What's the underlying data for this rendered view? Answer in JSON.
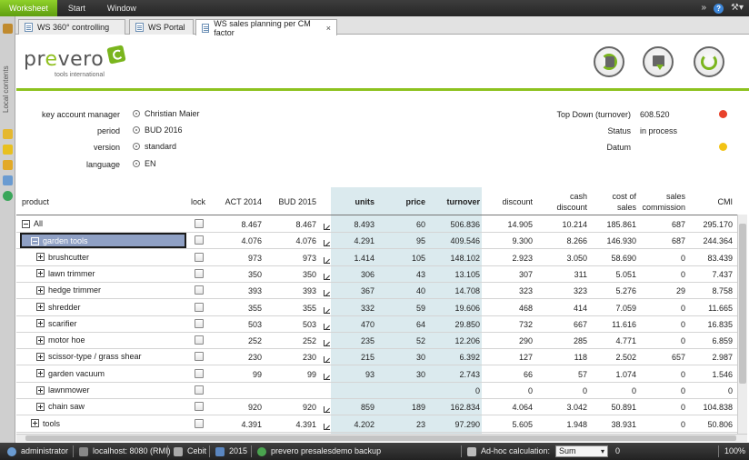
{
  "menu": {
    "items": [
      "Worksheet",
      "Start",
      "Window"
    ],
    "active": "Worksheet"
  },
  "tabs": [
    {
      "label": "WS 360° controlling",
      "active": false
    },
    {
      "label": "WS Portal",
      "active": false
    },
    {
      "label": "WS sales planning per CM factor",
      "active": true,
      "closable": true
    }
  ],
  "tab_close": "×",
  "left_strip_label": "Local contents",
  "logo": {
    "text_pre": "pr",
    "text_e": "e",
    "text_post": "vero",
    "tagline": "tools international"
  },
  "params": {
    "left": [
      {
        "label": "key account manager",
        "value": "Christian Maier"
      },
      {
        "label": "period",
        "value": "BUD 2016"
      },
      {
        "label": "version",
        "value": "standard"
      },
      {
        "label": "language",
        "value": "EN"
      }
    ],
    "right": [
      {
        "label": "Top Down (turnover)",
        "value": "608.520",
        "dot_color": "#e8412b"
      },
      {
        "label": "Status",
        "value": "in process"
      },
      {
        "label": "Datum",
        "value": "",
        "dot_color": "#f2c315"
      }
    ]
  },
  "table": {
    "headers": {
      "product": "product",
      "lock": "lock",
      "act2014": "ACT 2014",
      "bud2015": "BUD 2015",
      "units": "units",
      "price": "price",
      "turnover": "turnover",
      "discount": "discount",
      "cash1": "cash",
      "cash2": "discount",
      "cost1": "cost of",
      "cost2": "sales",
      "comm1": "sales",
      "comm2": "commission",
      "cmi": "CMI"
    },
    "rows": [
      {
        "name": "All",
        "level": 0,
        "expander": "minus",
        "act": "8.467",
        "bud": "8.467",
        "units": "8.493",
        "price": "60",
        "turnover": "506.836",
        "discount": "14.905",
        "cash": "10.214",
        "cost": "185.861",
        "comm": "687",
        "cmi": "295.170"
      },
      {
        "name": "garden tools",
        "level": 1,
        "expander": "minus",
        "selected": true,
        "act": "4.076",
        "bud": "4.076",
        "units": "4.291",
        "price": "95",
        "turnover": "409.546",
        "discount": "9.300",
        "cash": "8.266",
        "cost": "146.930",
        "comm": "687",
        "cmi": "244.364"
      },
      {
        "name": "brushcutter",
        "level": 2,
        "expander": "plus",
        "act": "973",
        "bud": "973",
        "units": "1.414",
        "price": "105",
        "turnover": "148.102",
        "discount": "2.923",
        "cash": "3.050",
        "cost": "58.690",
        "comm": "0",
        "cmi": "83.439"
      },
      {
        "name": "lawn trimmer",
        "level": 2,
        "expander": "plus",
        "act": "350",
        "bud": "350",
        "units": "306",
        "price": "43",
        "turnover": "13.105",
        "discount": "307",
        "cash": "311",
        "cost": "5.051",
        "comm": "0",
        "cmi": "7.437"
      },
      {
        "name": "hedge trimmer",
        "level": 2,
        "expander": "plus",
        "act": "393",
        "bud": "393",
        "units": "367",
        "price": "40",
        "turnover": "14.708",
        "discount": "323",
        "cash": "323",
        "cost": "5.276",
        "comm": "29",
        "cmi": "8.758"
      },
      {
        "name": "shredder",
        "level": 2,
        "expander": "plus",
        "act": "355",
        "bud": "355",
        "units": "332",
        "price": "59",
        "turnover": "19.606",
        "discount": "468",
        "cash": "414",
        "cost": "7.059",
        "comm": "0",
        "cmi": "11.665"
      },
      {
        "name": "scarifier",
        "level": 2,
        "expander": "plus",
        "act": "503",
        "bud": "503",
        "units": "470",
        "price": "64",
        "turnover": "29.850",
        "discount": "732",
        "cash": "667",
        "cost": "11.616",
        "comm": "0",
        "cmi": "16.835"
      },
      {
        "name": "motor hoe",
        "level": 2,
        "expander": "plus",
        "act": "252",
        "bud": "252",
        "units": "235",
        "price": "52",
        "turnover": "12.206",
        "discount": "290",
        "cash": "285",
        "cost": "4.771",
        "comm": "0",
        "cmi": "6.859"
      },
      {
        "name": "scissor-type / grass shear",
        "level": 2,
        "expander": "plus",
        "act": "230",
        "bud": "230",
        "units": "215",
        "price": "30",
        "turnover": "6.392",
        "discount": "127",
        "cash": "118",
        "cost": "2.502",
        "comm": "657",
        "cmi": "2.987"
      },
      {
        "name": "garden vacuum",
        "level": 2,
        "expander": "plus",
        "act": "99",
        "bud": "99",
        "units": "93",
        "price": "30",
        "turnover": "2.743",
        "discount": "66",
        "cash": "57",
        "cost": "1.074",
        "comm": "0",
        "cmi": "1.546"
      },
      {
        "name": "lawnmower",
        "level": 2,
        "expander": "plus",
        "act": "",
        "bud": "",
        "units": "",
        "price": "",
        "turnover": "0",
        "discount": "0",
        "cash": "0",
        "cost": "0",
        "comm": "0",
        "cmi": "0"
      },
      {
        "name": "chain saw",
        "level": 2,
        "expander": "plus",
        "act": "920",
        "bud": "920",
        "units": "859",
        "price": "189",
        "turnover": "162.834",
        "discount": "4.064",
        "cash": "3.042",
        "cost": "50.891",
        "comm": "0",
        "cmi": "104.838"
      },
      {
        "name": "tools",
        "level": 1,
        "expander": "plus",
        "act": "4.391",
        "bud": "4.391",
        "units": "4.202",
        "price": "23",
        "turnover": "97.290",
        "discount": "5.605",
        "cash": "1.948",
        "cost": "38.931",
        "comm": "0",
        "cmi": "50.806"
      }
    ]
  },
  "status": {
    "user": "administrator",
    "server": "localhost: 8080 (RMI)",
    "db": "Cebit",
    "year": "2015",
    "app": "prevero presalesdemo backup",
    "adhoc_label": "Ad-hoc calculation:",
    "adhoc_mode": "Sum",
    "adhoc_value": "0",
    "zoom": "100%"
  }
}
